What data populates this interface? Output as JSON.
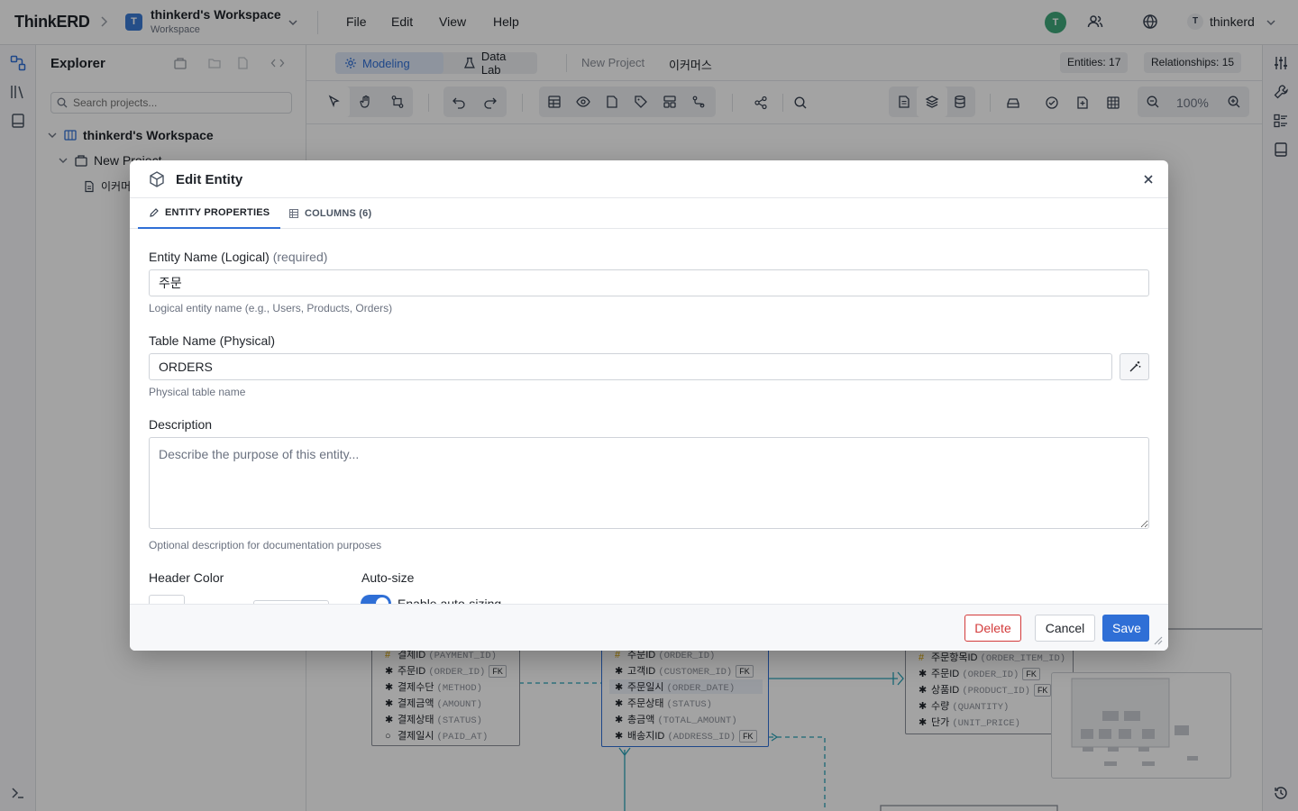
{
  "app": {
    "logo": "ThinkERD",
    "workspace_badge": "T",
    "workspace_name": "thinkerd's Workspace",
    "workspace_sub": "Workspace",
    "menus": [
      "File",
      "Edit",
      "View",
      "Help"
    ],
    "presence_avatar": "T",
    "user_initial": "T",
    "user_name": "thinkerd"
  },
  "explorer": {
    "title": "Explorer",
    "search_placeholder": "Search projects...",
    "tree": [
      {
        "label": "thinkerd's Workspace",
        "level": 0
      },
      {
        "label": "New Project",
        "level": 1
      },
      {
        "label": "이커머스",
        "level": 2
      }
    ]
  },
  "canvas_header": {
    "tabs": [
      {
        "label": "Modeling",
        "active": true
      },
      {
        "label": "Data Lab",
        "active": false
      }
    ],
    "breadcrumb": [
      "New Project",
      "이커머스"
    ],
    "entities_pill": "Entities: 17",
    "relationships_pill": "Relationships: 15",
    "zoom": "100%"
  },
  "diagram": {
    "entities": [
      {
        "id": "payment",
        "rows": [
          {
            "mark": "#",
            "name": "결제ID",
            "phys": "(PAYMENT_ID)",
            "fk": false
          },
          {
            "mark": "✱",
            "name": "주문ID",
            "phys": "(ORDER_ID)",
            "fk": true
          },
          {
            "mark": "✱",
            "name": "결제수단",
            "phys": "(METHOD)",
            "fk": false
          },
          {
            "mark": "✱",
            "name": "결제금액",
            "phys": "(AMOUNT)",
            "fk": false
          },
          {
            "mark": "✱",
            "name": "결제상태",
            "phys": "(STATUS)",
            "fk": false
          },
          {
            "mark": "○",
            "name": "결제일시",
            "phys": "(PAID_AT)",
            "fk": false
          }
        ]
      },
      {
        "id": "orders",
        "rows": [
          {
            "mark": "#",
            "name": "주문ID",
            "phys": "(ORDER_ID)",
            "fk": false
          },
          {
            "mark": "✱",
            "name": "고객ID",
            "phys": "(CUSTOMER_ID)",
            "fk": true
          },
          {
            "mark": "✱",
            "name": "주문일시",
            "phys": "(ORDER_DATE)",
            "fk": false
          },
          {
            "mark": "✱",
            "name": "주문상태",
            "phys": "(STATUS)",
            "fk": false
          },
          {
            "mark": "✱",
            "name": "총금액",
            "phys": "(TOTAL_AMOUNT)",
            "fk": false
          },
          {
            "mark": "✱",
            "name": "배송지ID",
            "phys": "(ADDRESS_ID)",
            "fk": true
          }
        ]
      },
      {
        "id": "order_item",
        "rows": [
          {
            "mark": "#",
            "name": "주문항목ID",
            "phys": "(ORDER_ITEM_ID)",
            "fk": false
          },
          {
            "mark": "✱",
            "name": "주문ID",
            "phys": "(ORDER_ID)",
            "fk": true
          },
          {
            "mark": "✱",
            "name": "상품ID",
            "phys": "(PRODUCT_ID)",
            "fk": true
          },
          {
            "mark": "✱",
            "name": "수량",
            "phys": "(QUANTITY)",
            "fk": false
          },
          {
            "mark": "✱",
            "name": "단가",
            "phys": "(UNIT_PRICE)",
            "fk": false
          }
        ]
      }
    ]
  },
  "modal": {
    "title": "Edit Entity",
    "tabs": [
      {
        "label": "ENTITY PROPERTIES",
        "active": true
      },
      {
        "label": "COLUMNS (6)",
        "active": false
      }
    ],
    "logical_label": "Entity Name (Logical)",
    "logical_required": "(required)",
    "logical_value": "주문",
    "logical_help": "Logical entity name (e.g., Users, Products, Orders)",
    "physical_label": "Table Name (Physical)",
    "physical_value": "ORDERS",
    "physical_help": "Physical table name",
    "description_label": "Description",
    "description_placeholder": "Describe the purpose of this entity...",
    "description_help": "Optional description for documentation purposes",
    "header_color_label": "Header Color",
    "autosize_label": "Auto-size",
    "autosize_toggle_label": "Enable auto-sizing",
    "autosize_enabled": true,
    "delete_label": "Delete",
    "cancel_label": "Cancel",
    "save_label": "Save"
  },
  "colors": {
    "accent": "#2f6fd6",
    "danger": "#d33a3a",
    "presence": "#3fa87a"
  }
}
